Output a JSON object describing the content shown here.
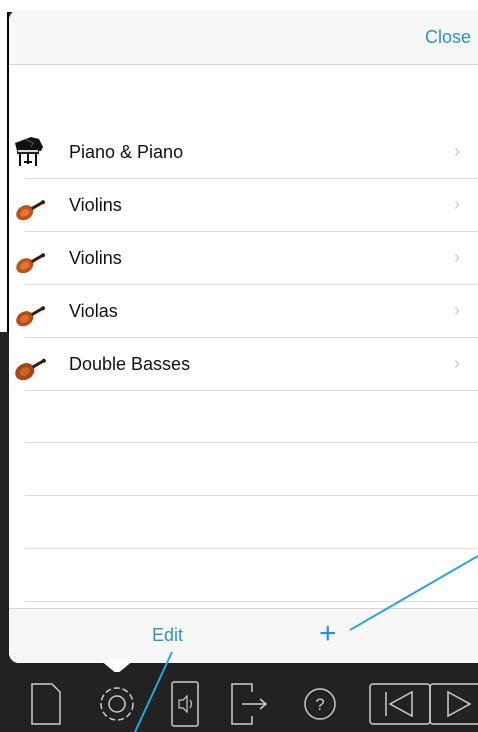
{
  "header": {
    "close_label": "Close"
  },
  "instruments": [
    {
      "name": "Piano & Piano",
      "icon": "grand-piano-icon"
    },
    {
      "name": "Violins",
      "icon": "violin-icon"
    },
    {
      "name": "Violins",
      "icon": "violin-icon"
    },
    {
      "name": "Violas",
      "icon": "violin-icon"
    },
    {
      "name": "Double Basses",
      "icon": "violin-icon"
    }
  ],
  "footer": {
    "edit_label": "Edit",
    "add_label": "+"
  },
  "chevron": "›",
  "toolbar": {
    "icons": [
      "document-icon",
      "gear-icon",
      "speaker-device-icon",
      "export-icon",
      "help-icon",
      "skip-back-icon",
      "play-icon"
    ]
  },
  "colors": {
    "accent": "#2d8fd5",
    "annotation": "#2aa7d8",
    "toolbar_bg": "#222222"
  }
}
